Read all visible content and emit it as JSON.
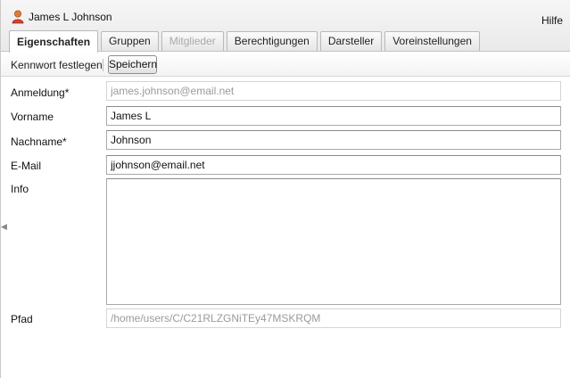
{
  "window": {
    "title": "James L Johnson",
    "help_label": "Hilfe"
  },
  "tabs": [
    {
      "label": "Eigenschaften",
      "state": "active"
    },
    {
      "label": "Gruppen",
      "state": "normal"
    },
    {
      "label": "Mitglieder",
      "state": "disabled"
    },
    {
      "label": "Berechtigungen",
      "state": "normal"
    },
    {
      "label": "Darsteller",
      "state": "normal"
    },
    {
      "label": "Voreinstellungen",
      "state": "normal"
    }
  ],
  "toolbar": {
    "set_password_label": "Kennwort festlegen",
    "save_label": "Speichern"
  },
  "form": {
    "login": {
      "label": "Anmeldung*",
      "value": "james.johnson@email.net",
      "readonly": true
    },
    "first_name": {
      "label": "Vorname",
      "value": "James L"
    },
    "last_name": {
      "label": "Nachname*",
      "value": "Johnson"
    },
    "email": {
      "label": "E-Mail",
      "value": "jjohnson@email.net"
    },
    "info": {
      "label": "Info",
      "value": ""
    },
    "path": {
      "label": "Pfad",
      "value": "/home/users/C/C21RLZGNiTEy47MSKRQM",
      "readonly": true
    }
  },
  "icons": {
    "title_icon": "user-icon",
    "collapse_handle": "chevron-left-icon"
  }
}
